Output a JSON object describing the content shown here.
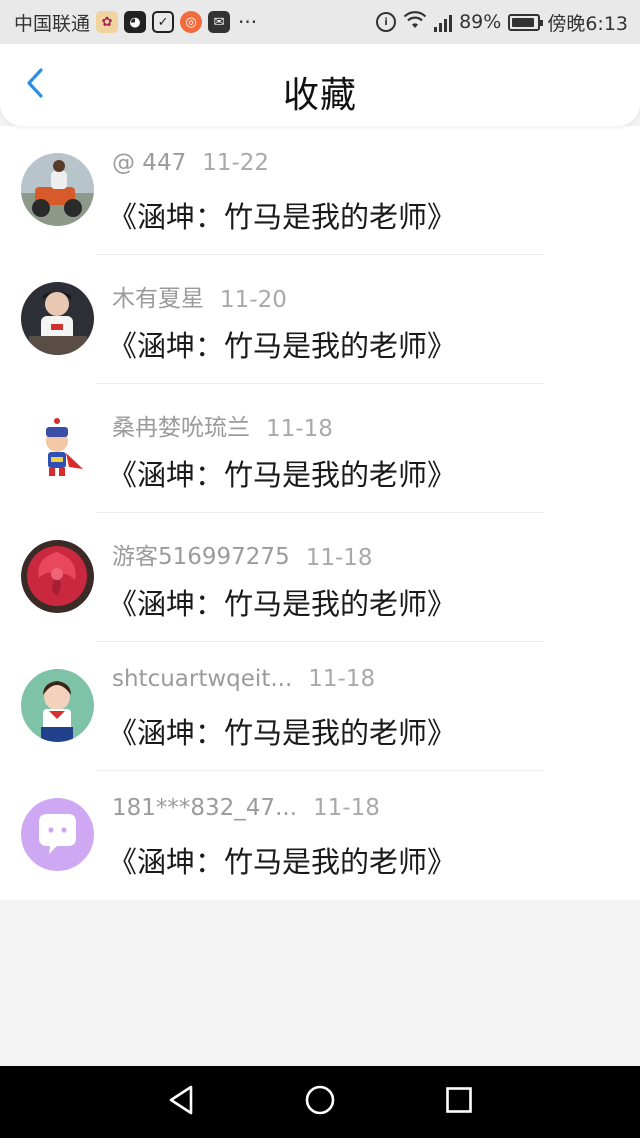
{
  "status_bar": {
    "carrier": "中国联通",
    "battery": "89%",
    "time": "傍晚6:13",
    "dots": "···"
  },
  "header": {
    "title": "收藏"
  },
  "items": [
    {
      "user": "@ 447",
      "date": "11-22",
      "title": "《涵坤：竹马是我的老师》"
    },
    {
      "user": "木有夏星",
      "date": "11-20",
      "title": "《涵坤：竹马是我的老师》"
    },
    {
      "user": "桑冉婪吮琉兰",
      "date": "11-18",
      "title": "《涵坤：竹马是我的老师》"
    },
    {
      "user": "游客516997275",
      "date": "11-18",
      "title": "《涵坤：竹马是我的老师》"
    },
    {
      "user": "shtcuartwqeit...",
      "date": "11-18",
      "title": "《涵坤：竹马是我的老师》"
    },
    {
      "user": "181***832_47...",
      "date": "11-18",
      "title": "《涵坤：竹马是我的老师》"
    }
  ],
  "colors": {
    "accent_blue": "#2b8ee6",
    "avatar_purple": "#cfa8f3",
    "rose_red": "#d9364d"
  },
  "icons": {
    "back": "chevron-left-icon",
    "nav_back": "triangle-back-icon",
    "nav_home": "circle-home-icon",
    "nav_recents": "square-recents-icon"
  }
}
